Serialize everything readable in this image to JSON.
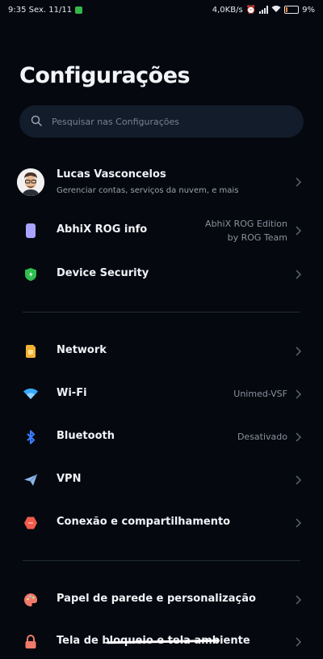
{
  "status_bar": {
    "time": "9:35 Sex. 11/11",
    "net_speed": "4,0KB/s",
    "battery": "9%",
    "colors": {
      "notification": "#35b84a",
      "battery_low": "#ff8a3d"
    }
  },
  "header": {
    "title": "Configurações"
  },
  "search": {
    "placeholder": "Pesquisar nas Configurações"
  },
  "account": {
    "name": "Lucas Vasconcelos",
    "subtitle": "Gerenciar contas, serviços da nuvem, e mais"
  },
  "items": [
    {
      "label": "AbhiX ROG info",
      "value_line1": "AbhiX ROG Edition",
      "value_line2": "by ROG Team",
      "icon": "phone-icon",
      "color": "#a9a4ff"
    },
    {
      "label": "Device Security",
      "icon": "shield-icon",
      "color": "#2fbf4f"
    },
    {
      "label": "Network",
      "icon": "sim-card-icon",
      "color": "#f2b233"
    },
    {
      "label": "Wi-Fi",
      "value": "Unimed-VSF",
      "icon": "wifi-icon",
      "color": "#37a8ff"
    },
    {
      "label": "Bluetooth",
      "value": "Desativado",
      "icon": "bluetooth-icon",
      "color": "#3b7cff"
    },
    {
      "label": "VPN",
      "icon": "send-icon",
      "color": "#8fb6e8"
    },
    {
      "label": "Conexão e compartilhamento",
      "icon": "share-icon",
      "color": "#f25b4b"
    },
    {
      "label": "Papel de parede e personalização",
      "icon": "palette-icon",
      "color": "#f07a6a"
    },
    {
      "label": "Tela de bloqueio e tela ambiente",
      "icon": "lock-icon",
      "color": "#f07a6a"
    }
  ]
}
